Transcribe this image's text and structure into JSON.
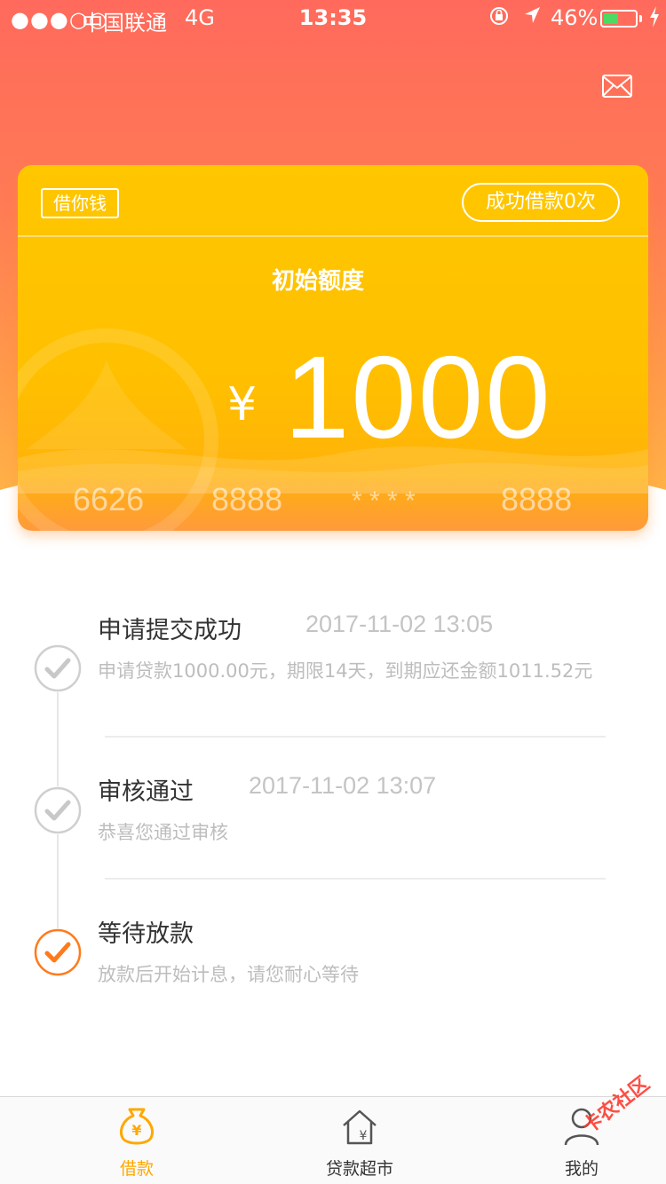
{
  "status_bar": {
    "signal": "●●●○○",
    "carrier": "中国联通",
    "network": "4G",
    "time": "13:35",
    "battery": "46%",
    "battery_level": 0.46
  },
  "card": {
    "brand_tag": "借你钱",
    "success_count": "成功借款0次",
    "limit_label": "初始额度",
    "currency": "¥",
    "amount": "1000",
    "card_number": [
      "6626",
      "8888",
      "* * * *",
      "8888"
    ]
  },
  "timeline": [
    {
      "title": "申请提交成功",
      "time": "2017-11-02 13:05",
      "desc": "申请贷款1000.00元，期限14天，到期应还金额1011.52元",
      "active": false
    },
    {
      "title": "审核通过",
      "time": "2017-11-02 13:07",
      "desc": "恭喜您通过审核",
      "active": false
    },
    {
      "title": "等待放款",
      "time": "",
      "desc": "放款后开始计息，请您耐心等待",
      "active": true
    }
  ],
  "tabs": [
    {
      "label": "借款",
      "icon": "money-bag-icon",
      "active": true
    },
    {
      "label": "贷款超市",
      "icon": "house-yen-icon",
      "active": false
    },
    {
      "label": "我的",
      "icon": "person-icon",
      "active": false
    }
  ],
  "watermark": "卡农社区",
  "colors": {
    "accent_orange": "#ff7a1a",
    "tab_active": "#ffa800",
    "card_yellow": "#ffc200",
    "header_red": "#ff6a5c"
  }
}
